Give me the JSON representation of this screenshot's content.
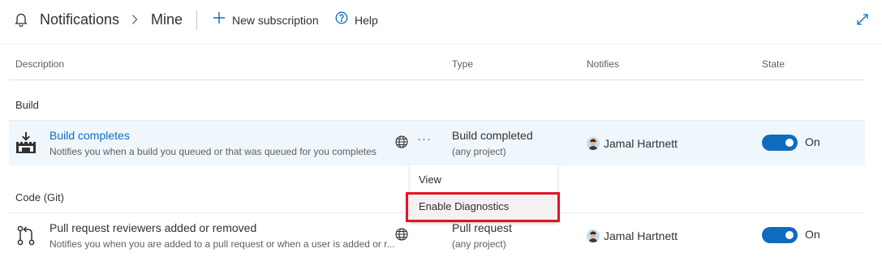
{
  "header": {
    "title": "Notifications",
    "breadcrumb": "Mine",
    "new_subscription_label": "New subscription",
    "help_label": "Help"
  },
  "columns": {
    "description": "Description",
    "type": "Type",
    "notifies": "Notifies",
    "state": "State"
  },
  "groups": [
    {
      "name": "Build",
      "rows": [
        {
          "title": "Build completes",
          "description": "Notifies you when a build you queued or that was queued for you completes",
          "type": "Build completed",
          "scope": "(any project)",
          "notifies": "Jamal Hartnett",
          "state": "On",
          "enabled": true,
          "icon": "build-icon"
        }
      ]
    },
    {
      "name": "Code (Git)",
      "rows": [
        {
          "title": "Pull request reviewers added or removed",
          "description": "Notifies you when you are added to a pull request or when a user is added or r...",
          "type": "Pull request",
          "scope": "(any project)",
          "notifies": "Jamal Hartnett",
          "state": "On",
          "enabled": true,
          "icon": "pull-request-icon"
        }
      ]
    }
  ],
  "context_menu": {
    "items": [
      "View",
      "Enable Diagnostics"
    ],
    "highlighted": "Enable Diagnostics"
  },
  "colors": {
    "accent": "#0f6cbd",
    "selected_row": "#eff6fc",
    "highlight_border": "#e81123"
  }
}
